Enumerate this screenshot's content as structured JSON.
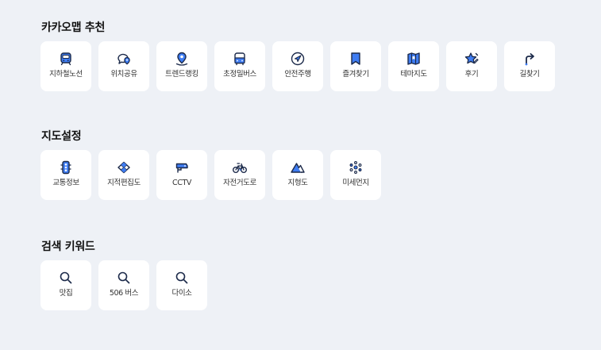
{
  "colors": {
    "accent": "#3f7df3",
    "dark": "#1c2a4a",
    "tile": "#ffffff",
    "background": "#eef1f6"
  },
  "recommend": {
    "title": "카카오맵 추천",
    "items": [
      {
        "label": "지하철노선",
        "icon": "subway-icon"
      },
      {
        "label": "위치공유",
        "icon": "location-share-icon"
      },
      {
        "label": "트렌드랭킹",
        "icon": "trend-ranking-icon"
      },
      {
        "label": "초정밀버스",
        "icon": "bus-icon"
      },
      {
        "label": "안전주행",
        "icon": "navigation-icon"
      },
      {
        "label": "즐겨찾기",
        "icon": "bookmark-icon"
      },
      {
        "label": "테마지도",
        "icon": "theme-map-icon"
      },
      {
        "label": "후기",
        "icon": "review-star-icon"
      },
      {
        "label": "길찾기",
        "icon": "directions-icon"
      }
    ]
  },
  "map_settings": {
    "title": "지도설정",
    "items": [
      {
        "label": "교통정보",
        "icon": "traffic-light-icon"
      },
      {
        "label": "지적편집도",
        "icon": "cadastral-map-icon"
      },
      {
        "label": "CCTV",
        "icon": "cctv-icon"
      },
      {
        "label": "자전거도로",
        "icon": "bicycle-icon"
      },
      {
        "label": "지형도",
        "icon": "terrain-icon"
      },
      {
        "label": "미세먼지",
        "icon": "fine-dust-icon"
      }
    ]
  },
  "keywords": {
    "title": "검색 키워드",
    "items": [
      {
        "label": "맛집",
        "icon": "search-icon"
      },
      {
        "label": "506 버스",
        "icon": "search-icon"
      },
      {
        "label": "다이소",
        "icon": "search-icon"
      }
    ]
  }
}
